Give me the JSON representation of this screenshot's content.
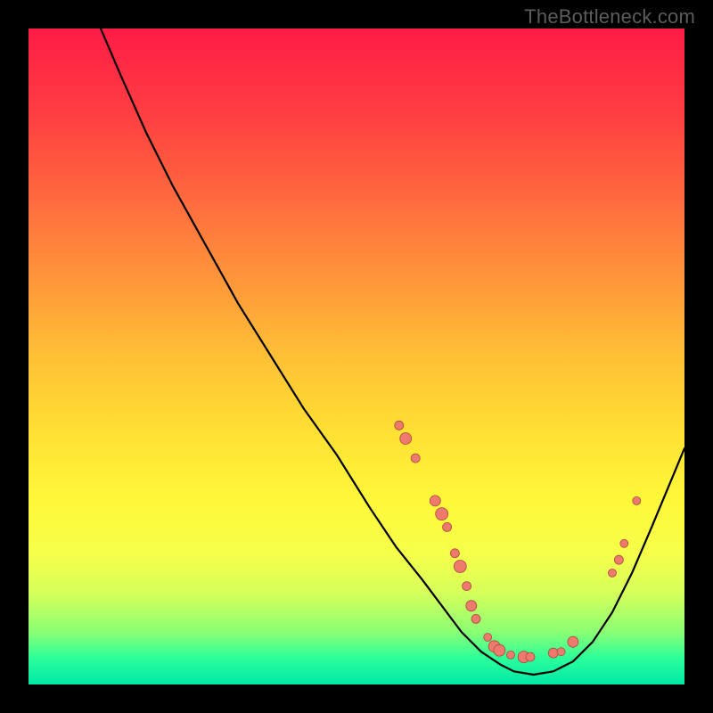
{
  "watermark": "TheBottleneck.com",
  "colors": {
    "page_bg": "#000000",
    "curve": "#000000",
    "marker_fill": "#ee7a6e",
    "marker_stroke": "#a84a3f",
    "gradient_stops": [
      "#ff1c46",
      "#ff3b42",
      "#ff6a3e",
      "#ff953a",
      "#ffc035",
      "#ffe133",
      "#fff83a",
      "#f6ff4a",
      "#d7ff5a",
      "#8aff74",
      "#2cff9a",
      "#00e8a8"
    ]
  },
  "chart_data": {
    "type": "line",
    "title": "",
    "xlabel": "",
    "ylabel": "",
    "xlim": [
      0,
      100
    ],
    "ylim": [
      0,
      100
    ],
    "note": "axes unlabeled in source image; x/y are normalized 0-100; y is inverted visually (0 at top)",
    "series": [
      {
        "name": "bottleneck-curve",
        "x": [
          11,
          14,
          18,
          22,
          27,
          32,
          37,
          42,
          47,
          52,
          56,
          60,
          63,
          66,
          69,
          72,
          74,
          77,
          80,
          83,
          86,
          89,
          92,
          95,
          100
        ],
        "y": [
          0,
          7,
          16,
          24,
          33,
          42,
          50,
          58,
          65,
          73,
          79,
          84,
          88,
          92,
          95,
          97,
          98,
          98.5,
          98,
          96.5,
          93.5,
          89,
          83,
          76,
          64
        ]
      }
    ],
    "markers": {
      "name": "highlight-points",
      "points": [
        {
          "x": 56.5,
          "y": 60.5,
          "r": 5
        },
        {
          "x": 57.5,
          "y": 62.5,
          "r": 6.5
        },
        {
          "x": 59.0,
          "y": 65.5,
          "r": 5
        },
        {
          "x": 62.0,
          "y": 72.0,
          "r": 6
        },
        {
          "x": 63.0,
          "y": 74.0,
          "r": 7
        },
        {
          "x": 63.8,
          "y": 76.0,
          "r": 5
        },
        {
          "x": 65.0,
          "y": 80.0,
          "r": 5
        },
        {
          "x": 65.8,
          "y": 82.0,
          "r": 7
        },
        {
          "x": 66.8,
          "y": 85.0,
          "r": 5
        },
        {
          "x": 67.5,
          "y": 88.0,
          "r": 6
        },
        {
          "x": 68.2,
          "y": 90.0,
          "r": 5
        },
        {
          "x": 70.0,
          "y": 92.8,
          "r": 4.5
        },
        {
          "x": 71.0,
          "y": 94.2,
          "r": 6.5
        },
        {
          "x": 71.8,
          "y": 94.8,
          "r": 6.5
        },
        {
          "x": 73.5,
          "y": 95.5,
          "r": 4.5
        },
        {
          "x": 75.5,
          "y": 95.8,
          "r": 6.5
        },
        {
          "x": 76.5,
          "y": 95.8,
          "r": 5
        },
        {
          "x": 80.0,
          "y": 95.2,
          "r": 5.5
        },
        {
          "x": 81.2,
          "y": 95.0,
          "r": 4.5
        },
        {
          "x": 83.0,
          "y": 93.5,
          "r": 6
        },
        {
          "x": 89.0,
          "y": 83.0,
          "r": 4.5
        },
        {
          "x": 90.0,
          "y": 81.0,
          "r": 5
        },
        {
          "x": 90.8,
          "y": 78.5,
          "r": 4.5
        },
        {
          "x": 92.7,
          "y": 72.0,
          "r": 4.5
        }
      ]
    }
  }
}
